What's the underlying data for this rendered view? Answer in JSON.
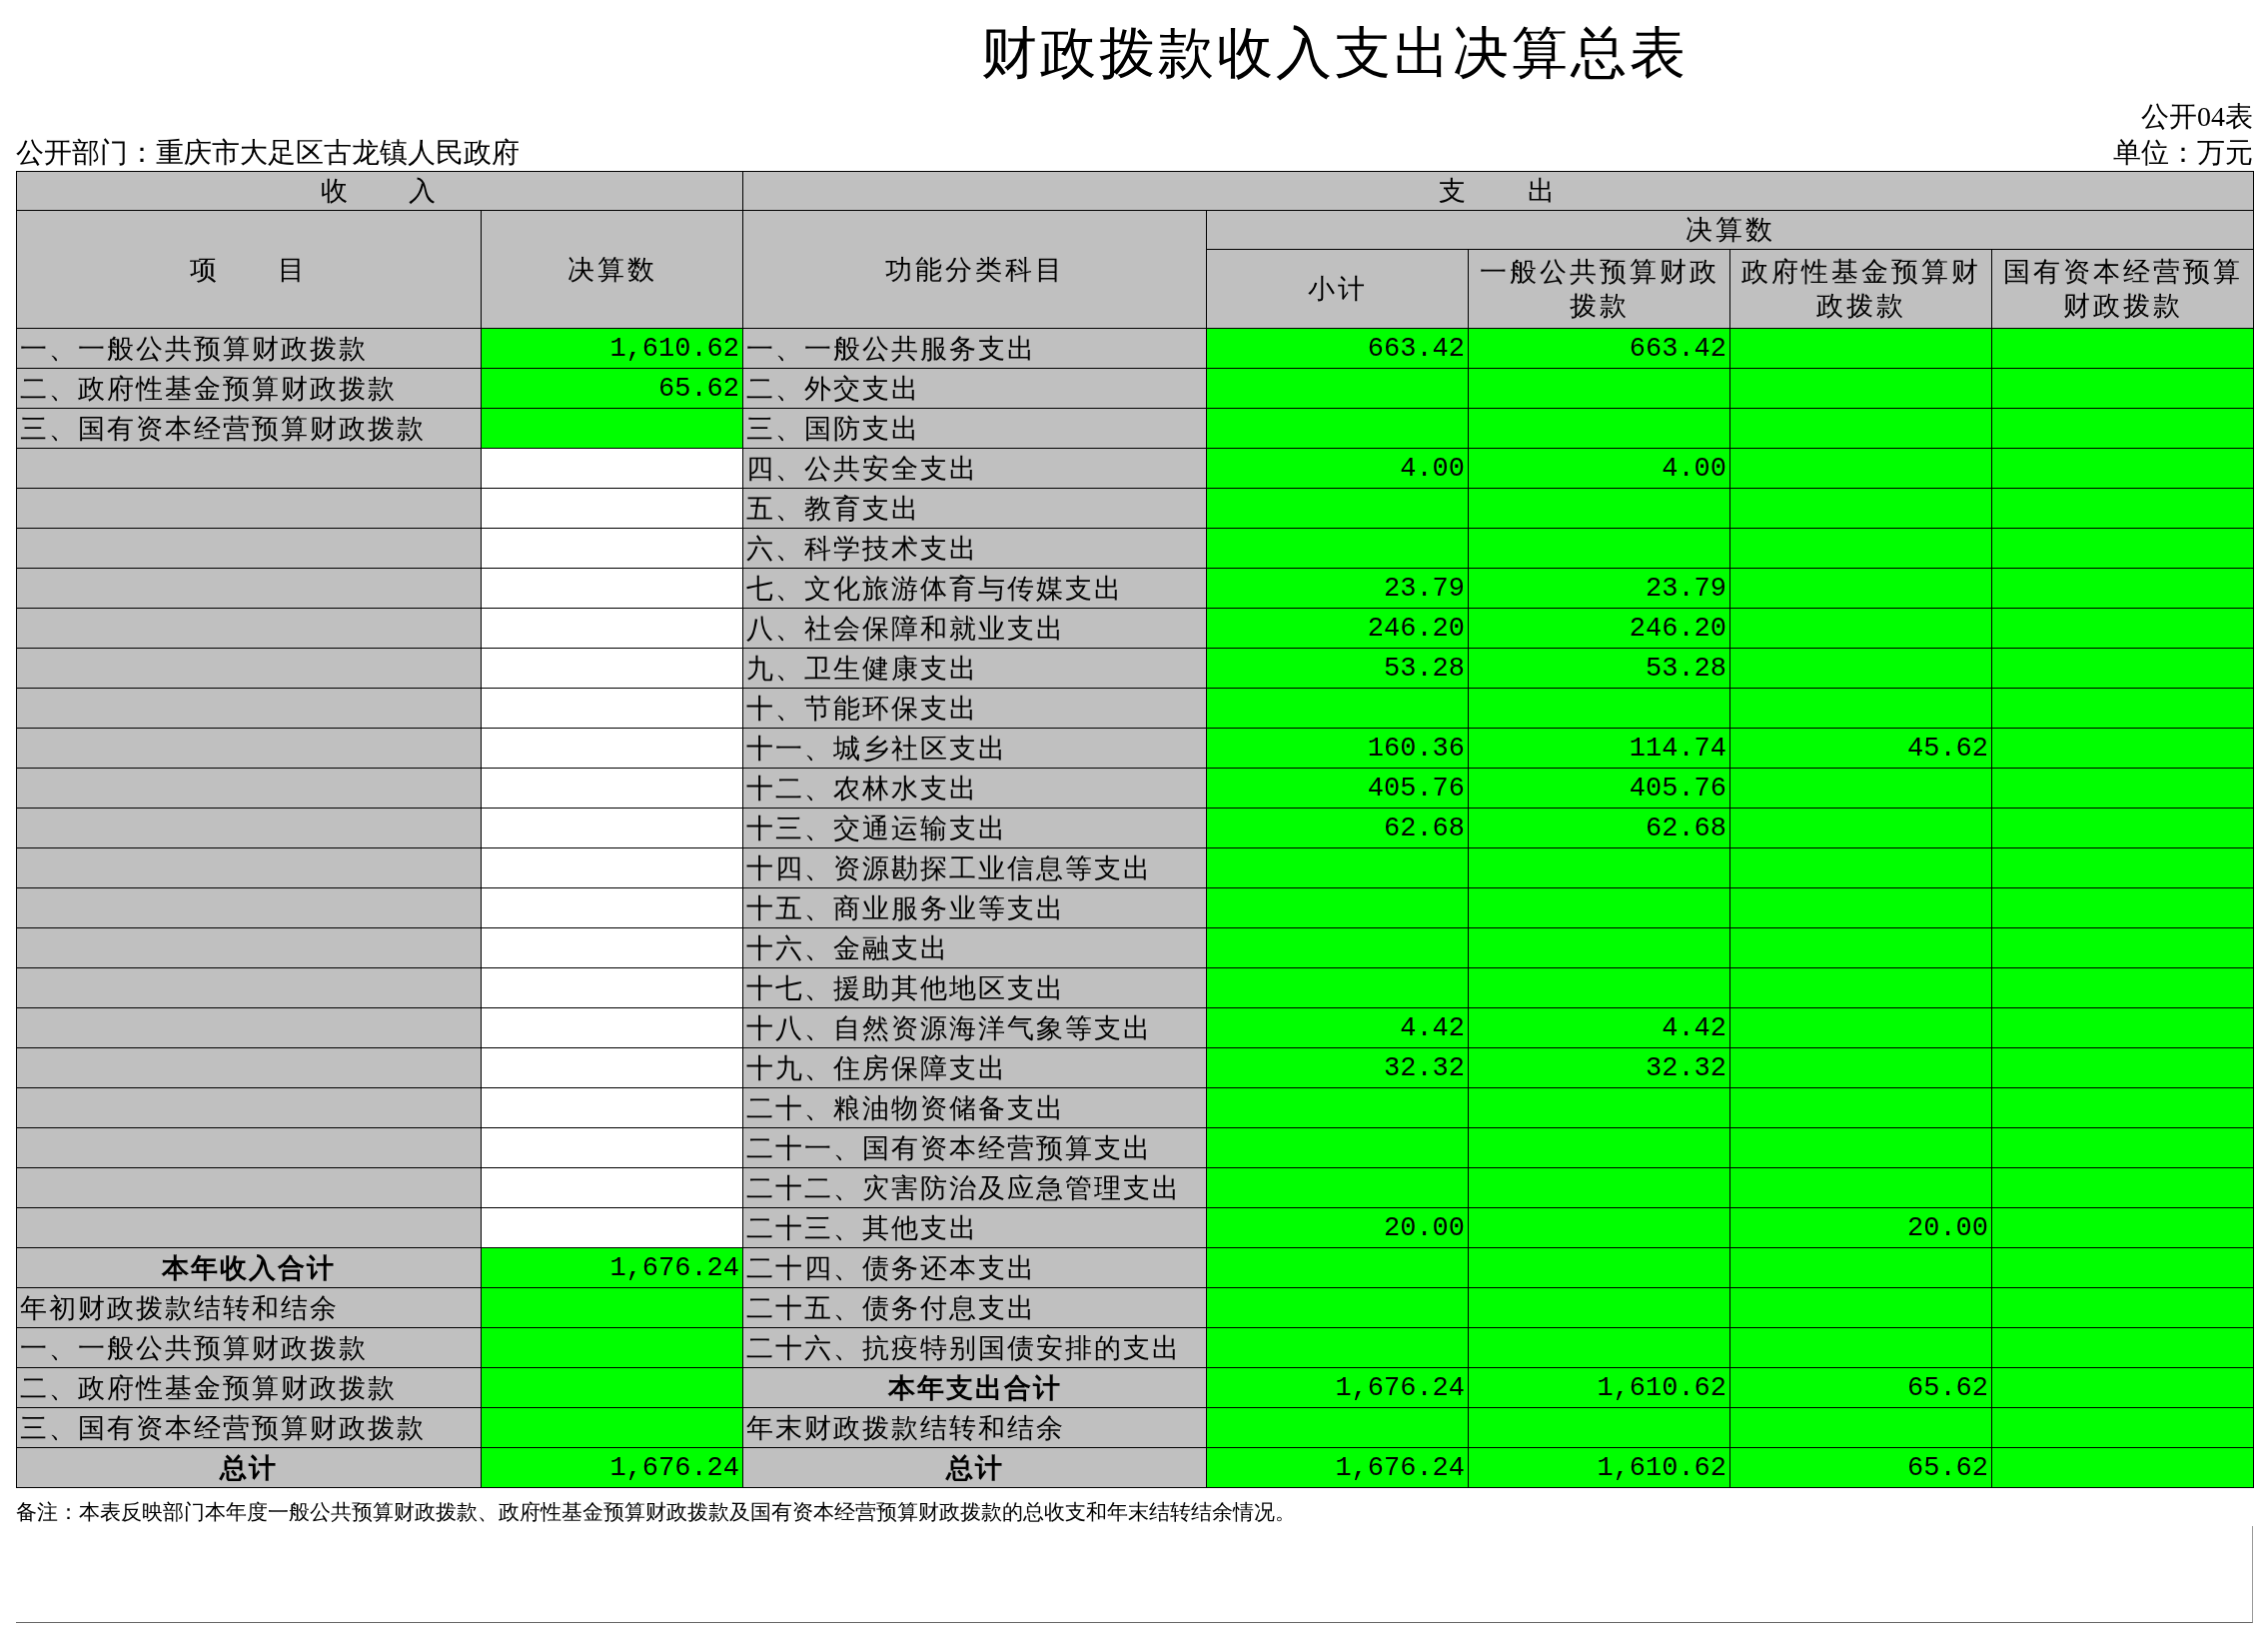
{
  "title": "财政拨款收入支出决算总表",
  "form_code": "公开04表",
  "department": "公开部门：重庆市大足区古龙镇人民政府",
  "unit": "单位：万元",
  "table": {
    "income_header": "收      入",
    "expense_header": "支      出",
    "columns": {
      "item": "项      目",
      "amount": "决算数",
      "function": "功能分类科目",
      "final_group": "决算数",
      "subtotal": "小计",
      "general": "一般公共预算财政拨款",
      "fund": "政府性基金预算财政拨款",
      "capital": "国有资本经营预算财政拨款"
    },
    "rows": [
      {
        "income": {
          "kind": "item",
          "item": "一、一般公共预算财政拨款",
          "amount": "1,610.62"
        },
        "expense": {
          "kind": "item",
          "item": "一、一般公共服务支出",
          "subtotal": "663.42",
          "general": "663.42"
        }
      },
      {
        "income": {
          "kind": "item",
          "item": "二、政府性基金预算财政拨款",
          "amount": "65.62"
        },
        "expense": {
          "kind": "item",
          "item": "二、外交支出"
        }
      },
      {
        "income": {
          "kind": "item",
          "item": "三、国有资本经营预算财政拨款"
        },
        "expense": {
          "kind": "item",
          "item": "三、国防支出"
        }
      },
      {
        "income": {
          "kind": "blank"
        },
        "expense": {
          "kind": "item",
          "item": "四、公共安全支出",
          "subtotal": "4.00",
          "general": "4.00"
        }
      },
      {
        "income": {
          "kind": "blank"
        },
        "expense": {
          "kind": "item",
          "item": "五、教育支出"
        }
      },
      {
        "income": {
          "kind": "blank"
        },
        "expense": {
          "kind": "item",
          "item": "六、科学技术支出"
        }
      },
      {
        "income": {
          "kind": "blank"
        },
        "expense": {
          "kind": "item",
          "item": "七、文化旅游体育与传媒支出",
          "subtotal": "23.79",
          "general": "23.79"
        }
      },
      {
        "income": {
          "kind": "blank"
        },
        "expense": {
          "kind": "item",
          "item": "八、社会保障和就业支出",
          "subtotal": "246.20",
          "general": "246.20"
        }
      },
      {
        "income": {
          "kind": "blank"
        },
        "expense": {
          "kind": "item",
          "item": "九、卫生健康支出",
          "subtotal": "53.28",
          "general": "53.28"
        }
      },
      {
        "income": {
          "kind": "blank"
        },
        "expense": {
          "kind": "item",
          "item": "十、节能环保支出"
        }
      },
      {
        "income": {
          "kind": "blank"
        },
        "expense": {
          "kind": "item",
          "item": "十一、城乡社区支出",
          "subtotal": "160.36",
          "general": "114.74",
          "fund": "45.62"
        }
      },
      {
        "income": {
          "kind": "blank"
        },
        "expense": {
          "kind": "item",
          "item": "十二、农林水支出",
          "subtotal": "405.76",
          "general": "405.76"
        }
      },
      {
        "income": {
          "kind": "blank"
        },
        "expense": {
          "kind": "item",
          "item": "十三、交通运输支出",
          "subtotal": "62.68",
          "general": "62.68"
        }
      },
      {
        "income": {
          "kind": "blank"
        },
        "expense": {
          "kind": "item",
          "item": "十四、资源勘探工业信息等支出"
        }
      },
      {
        "income": {
          "kind": "blank"
        },
        "expense": {
          "kind": "item",
          "item": "十五、商业服务业等支出"
        }
      },
      {
        "income": {
          "kind": "blank"
        },
        "expense": {
          "kind": "item",
          "item": "十六、金融支出"
        }
      },
      {
        "income": {
          "kind": "blank"
        },
        "expense": {
          "kind": "item",
          "item": "十七、援助其他地区支出"
        }
      },
      {
        "income": {
          "kind": "blank"
        },
        "expense": {
          "kind": "item",
          "item": "十八、自然资源海洋气象等支出",
          "subtotal": "4.42",
          "general": "4.42"
        }
      },
      {
        "income": {
          "kind": "blank"
        },
        "expense": {
          "kind": "item",
          "item": "十九、住房保障支出",
          "subtotal": "32.32",
          "general": "32.32"
        }
      },
      {
        "income": {
          "kind": "blank"
        },
        "expense": {
          "kind": "item",
          "item": "二十、粮油物资储备支出"
        }
      },
      {
        "income": {
          "kind": "blank"
        },
        "expense": {
          "kind": "item",
          "item": "二十一、国有资本经营预算支出"
        }
      },
      {
        "income": {
          "kind": "blank"
        },
        "expense": {
          "kind": "item",
          "item": "二十二、灾害防治及应急管理支出"
        }
      },
      {
        "income": {
          "kind": "blank"
        },
        "expense": {
          "kind": "item",
          "item": "二十三、其他支出",
          "subtotal": "20.00",
          "fund": "20.00"
        }
      },
      {
        "income": {
          "kind": "total",
          "item": "本年收入合计",
          "amount": "1,676.24"
        },
        "expense": {
          "kind": "item",
          "item": "二十四、债务还本支出"
        }
      },
      {
        "income": {
          "kind": "item",
          "item": "年初财政拨款结转和结余"
        },
        "expense": {
          "kind": "item",
          "item": "二十五、债务付息支出"
        }
      },
      {
        "income": {
          "kind": "item",
          "item": "一、一般公共预算财政拨款"
        },
        "expense": {
          "kind": "item",
          "item": "二十六、抗疫特别国债安排的支出"
        }
      },
      {
        "income": {
          "kind": "item",
          "item": "二、政府性基金预算财政拨款"
        },
        "expense": {
          "kind": "total",
          "item": "本年支出合计",
          "subtotal": "1,676.24",
          "general": "1,610.62",
          "fund": "65.62"
        }
      },
      {
        "income": {
          "kind": "item",
          "item": "三、国有资本经营预算财政拨款"
        },
        "expense": {
          "kind": "item",
          "item": "年末财政拨款结转和结余"
        }
      },
      {
        "income": {
          "kind": "total",
          "item": "总计",
          "amount": "1,676.24"
        },
        "expense": {
          "kind": "total",
          "item": "总计",
          "subtotal": "1,676.24",
          "general": "1,610.62",
          "fund": "65.62"
        }
      }
    ]
  },
  "note": "备注：本表反映部门本年度一般公共预算财政拨款、政府性基金预算财政拨款及国有资本经营预算财政拨款的总收支和年末结转结余情况。"
}
